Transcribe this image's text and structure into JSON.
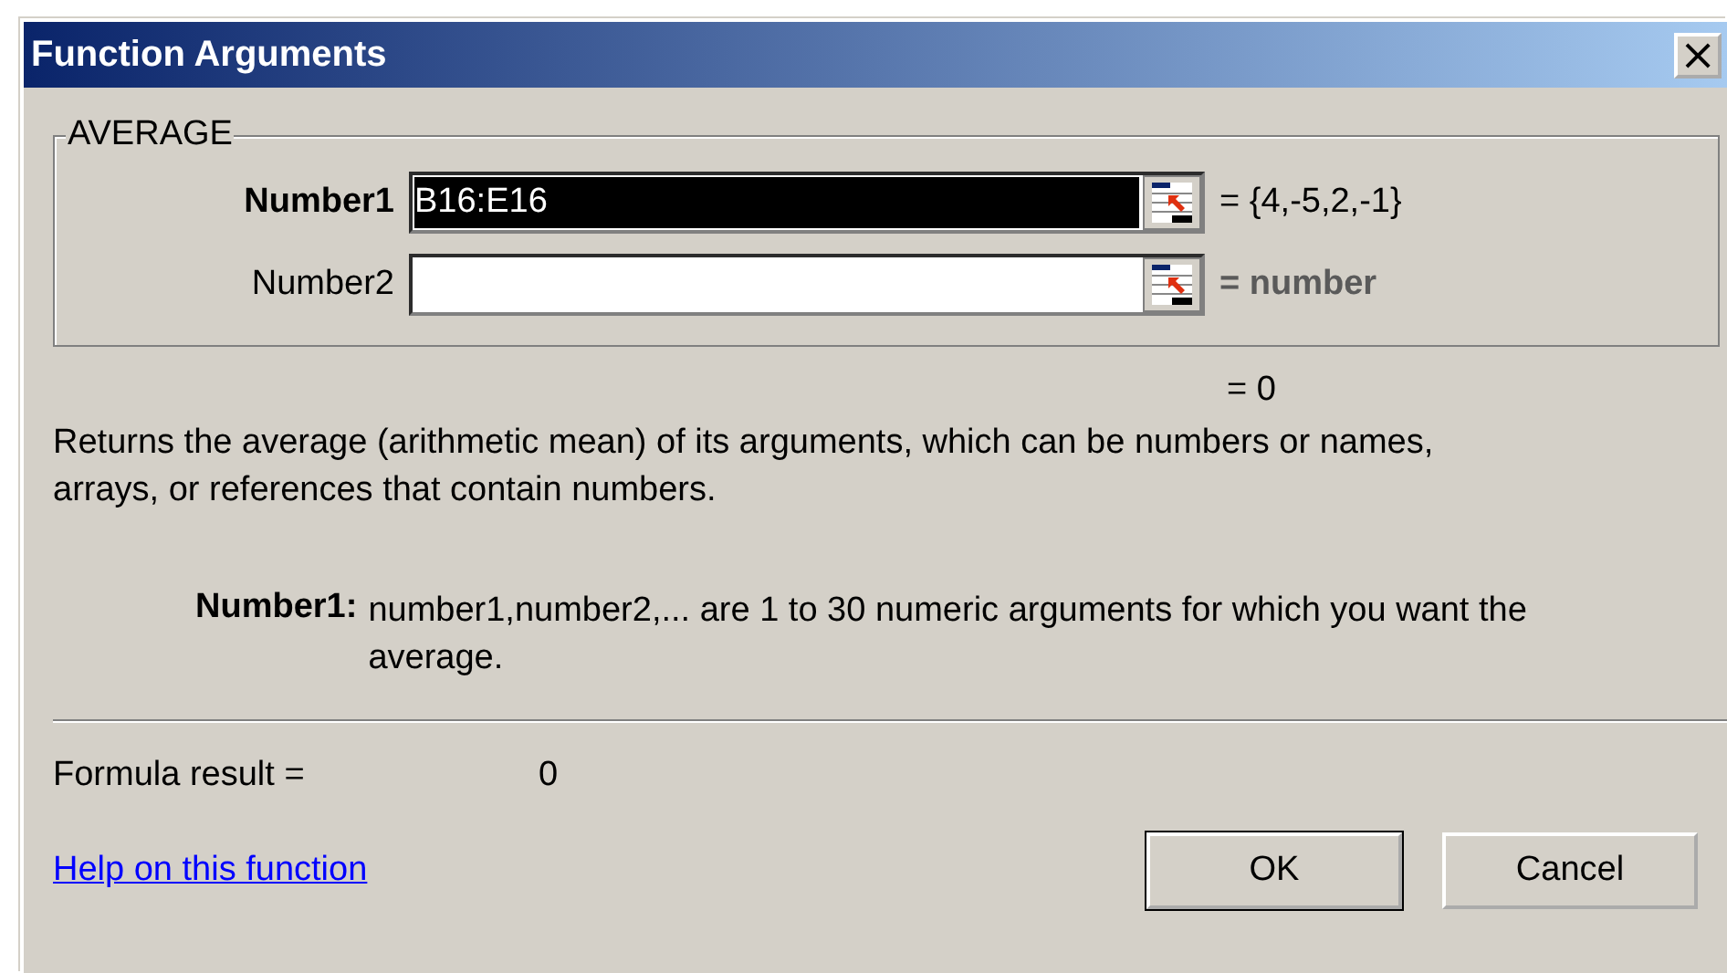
{
  "window": {
    "title": "Function Arguments",
    "close": "×"
  },
  "function_name": "AVERAGE",
  "arguments": [
    {
      "label": "Number1",
      "value": "B16:E16",
      "selected": true,
      "result": "= {4,-5,2,-1}",
      "result_dimmed": false
    },
    {
      "label": "Number2",
      "selected": false,
      "result": "= number",
      "result_dimmed": true
    }
  ],
  "overall_result": "= 0",
  "description": "Returns the average (arithmetic mean) of its arguments, which can be numbers or names, arrays, or references that contain numbers.",
  "argument_help": {
    "label": "Number1:",
    "text": "number1,number2,... are 1 to 30 numeric arguments for which you want the average."
  },
  "formula_result": {
    "label": "Formula result =",
    "value": "0"
  },
  "help_link": "Help on this function",
  "buttons": [
    {
      "label": "OK",
      "default": true
    },
    {
      "label": "Cancel",
      "default": false
    }
  ]
}
